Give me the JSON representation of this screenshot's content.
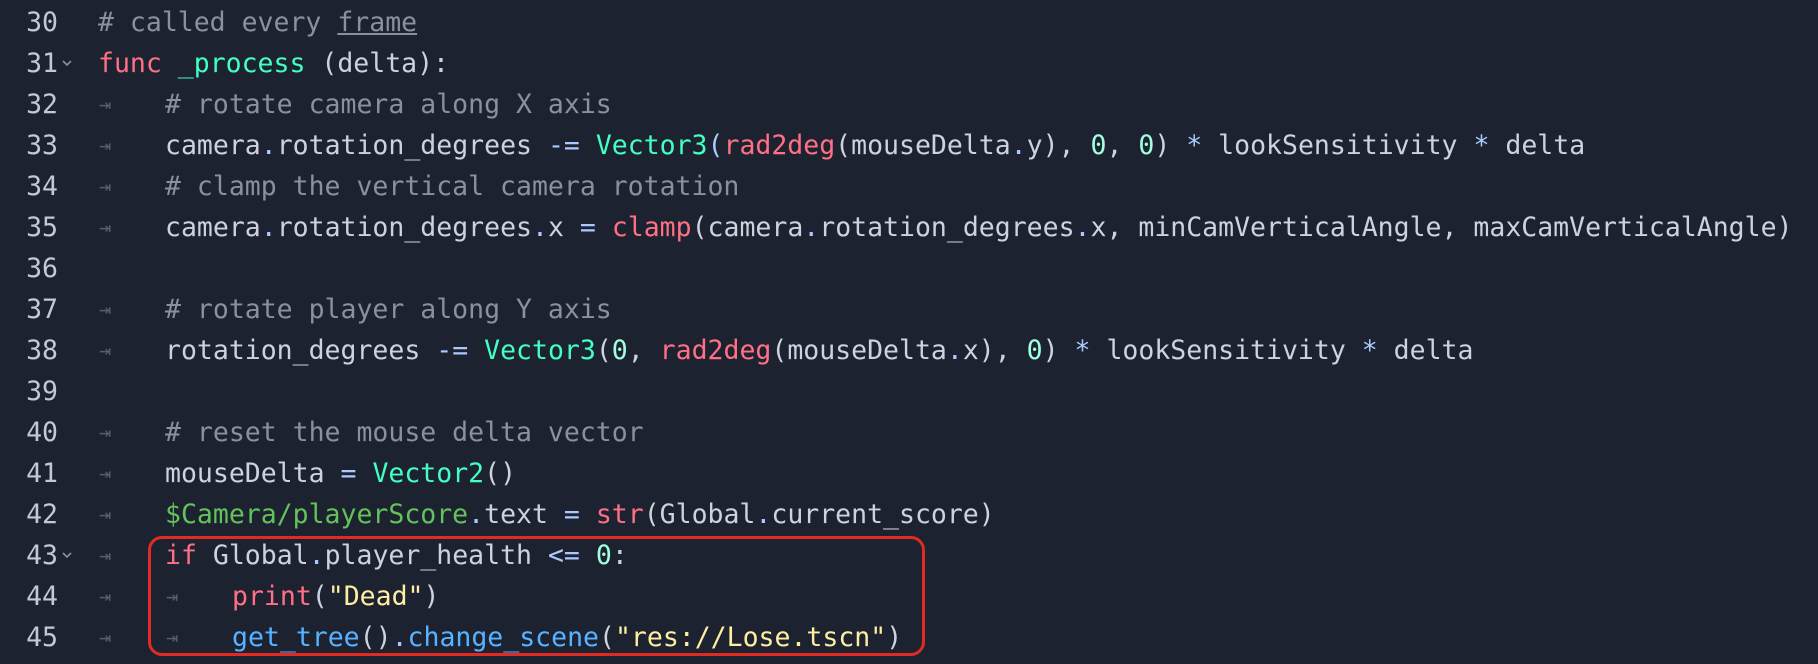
{
  "editor": {
    "lines": [
      {
        "num": "30",
        "indent": 0,
        "fold": false,
        "tokens": [
          {
            "t": "# called every ",
            "c": "comment"
          },
          {
            "t": "frame",
            "c": "comment u"
          }
        ]
      },
      {
        "num": "31",
        "indent": 0,
        "fold": true,
        "tokens": [
          {
            "t": "func ",
            "c": "keyword"
          },
          {
            "t": "_process",
            "c": "type"
          },
          {
            "t": " (delta):",
            "c": ""
          }
        ]
      },
      {
        "num": "32",
        "indent": 1,
        "fold": false,
        "tokens": [
          {
            "t": "# rotate camera along X axis",
            "c": "comment"
          }
        ]
      },
      {
        "num": "33",
        "indent": 1,
        "fold": false,
        "tokens": [
          {
            "t": "camera",
            "c": ""
          },
          {
            "t": ".",
            "c": "op"
          },
          {
            "t": "rotation_degrees ",
            "c": ""
          },
          {
            "t": "-=",
            "c": "op"
          },
          {
            "t": " ",
            "c": ""
          },
          {
            "t": "Vector3",
            "c": "type"
          },
          {
            "t": "(",
            "c": "op"
          },
          {
            "t": "rad2deg",
            "c": "builtin"
          },
          {
            "t": "(mouseDelta",
            "c": ""
          },
          {
            "t": ".",
            "c": "op"
          },
          {
            "t": "y), ",
            "c": ""
          },
          {
            "t": "0",
            "c": "num"
          },
          {
            "t": ", ",
            "c": ""
          },
          {
            "t": "0",
            "c": "num"
          },
          {
            "t": ") ",
            "c": ""
          },
          {
            "t": "*",
            "c": "op"
          },
          {
            "t": " lookSensitivity ",
            "c": ""
          },
          {
            "t": "*",
            "c": "op"
          },
          {
            "t": " delta",
            "c": ""
          }
        ]
      },
      {
        "num": "34",
        "indent": 1,
        "fold": false,
        "tokens": [
          {
            "t": "# clamp the vertical camera rotation",
            "c": "comment"
          }
        ]
      },
      {
        "num": "35",
        "indent": 1,
        "fold": false,
        "tokens": [
          {
            "t": "camera",
            "c": ""
          },
          {
            "t": ".",
            "c": "op"
          },
          {
            "t": "rotation_degrees",
            "c": ""
          },
          {
            "t": ".",
            "c": "op"
          },
          {
            "t": "x ",
            "c": ""
          },
          {
            "t": "=",
            "c": "op"
          },
          {
            "t": " ",
            "c": ""
          },
          {
            "t": "clamp",
            "c": "builtin"
          },
          {
            "t": "(camera",
            "c": ""
          },
          {
            "t": ".",
            "c": "op"
          },
          {
            "t": "rotation_degrees",
            "c": ""
          },
          {
            "t": ".",
            "c": "op"
          },
          {
            "t": "x, minCamVerticalAngle, maxCamVerticalAngle)",
            "c": ""
          }
        ]
      },
      {
        "num": "36",
        "indent": 0,
        "fold": false,
        "tokens": []
      },
      {
        "num": "37",
        "indent": 1,
        "fold": false,
        "tokens": [
          {
            "t": "# rotate player along Y axis",
            "c": "comment"
          }
        ]
      },
      {
        "num": "38",
        "indent": 1,
        "fold": false,
        "tokens": [
          {
            "t": "rotation_degrees ",
            "c": ""
          },
          {
            "t": "-=",
            "c": "op"
          },
          {
            "t": " ",
            "c": ""
          },
          {
            "t": "Vector3",
            "c": "type"
          },
          {
            "t": "(",
            "c": ""
          },
          {
            "t": "0",
            "c": "num"
          },
          {
            "t": ", ",
            "c": ""
          },
          {
            "t": "rad2deg",
            "c": "builtin"
          },
          {
            "t": "(mouseDelta",
            "c": ""
          },
          {
            "t": ".",
            "c": "op"
          },
          {
            "t": "x), ",
            "c": ""
          },
          {
            "t": "0",
            "c": "num"
          },
          {
            "t": ") ",
            "c": ""
          },
          {
            "t": "*",
            "c": "op"
          },
          {
            "t": " lookSensitivity ",
            "c": ""
          },
          {
            "t": "*",
            "c": "op"
          },
          {
            "t": " delta",
            "c": ""
          }
        ]
      },
      {
        "num": "39",
        "indent": 0,
        "fold": false,
        "tokens": []
      },
      {
        "num": "40",
        "indent": 1,
        "fold": false,
        "tokens": [
          {
            "t": "# reset the mouse delta vector",
            "c": "comment"
          }
        ]
      },
      {
        "num": "41",
        "indent": 1,
        "fold": false,
        "tokens": [
          {
            "t": "mouseDelta ",
            "c": ""
          },
          {
            "t": "=",
            "c": "op"
          },
          {
            "t": " ",
            "c": ""
          },
          {
            "t": "Vector2",
            "c": "type"
          },
          {
            "t": "()",
            "c": ""
          }
        ]
      },
      {
        "num": "42",
        "indent": 1,
        "fold": false,
        "tokens": [
          {
            "t": "$Camera/playerScore",
            "c": "node"
          },
          {
            "t": ".",
            "c": "op"
          },
          {
            "t": "text ",
            "c": ""
          },
          {
            "t": "=",
            "c": "op"
          },
          {
            "t": " ",
            "c": ""
          },
          {
            "t": "str",
            "c": "builtin"
          },
          {
            "t": "(Global",
            "c": ""
          },
          {
            "t": ".",
            "c": "op"
          },
          {
            "t": "current_score)",
            "c": ""
          }
        ]
      },
      {
        "num": "43",
        "indent": 1,
        "fold": true,
        "tokens": [
          {
            "t": "if",
            "c": "keyword"
          },
          {
            "t": " Global",
            "c": ""
          },
          {
            "t": ".",
            "c": "op"
          },
          {
            "t": "player_health ",
            "c": ""
          },
          {
            "t": "<=",
            "c": "op"
          },
          {
            "t": " ",
            "c": ""
          },
          {
            "t": "0",
            "c": "num"
          },
          {
            "t": ":",
            "c": ""
          }
        ]
      },
      {
        "num": "44",
        "indent": 2,
        "fold": false,
        "tokens": [
          {
            "t": "print",
            "c": "builtin"
          },
          {
            "t": "(",
            "c": ""
          },
          {
            "t": "\"Dead\"",
            "c": "str"
          },
          {
            "t": ")",
            "c": ""
          }
        ]
      },
      {
        "num": "45",
        "indent": 2,
        "fold": false,
        "tokens": [
          {
            "t": "get_tree",
            "c": "func"
          },
          {
            "t": "()",
            "c": ""
          },
          {
            "t": ".",
            "c": "op"
          },
          {
            "t": "change_scene",
            "c": "func"
          },
          {
            "t": "(",
            "c": ""
          },
          {
            "t": "\"res://Lose.tscn\"",
            "c": "str"
          },
          {
            "t": ")",
            "c": ""
          }
        ]
      }
    ]
  },
  "colors": {
    "background": "#1d2230",
    "line_number": "#c3c8d4",
    "comment": "#8a909e",
    "keyword": "#ff7085",
    "type": "#42ffc2",
    "number": "#a1ffe0",
    "string": "#ffeda1",
    "function": "#57b3ff",
    "node_path": "#63c259",
    "highlight_box": "#e02a22"
  },
  "icons": {
    "fold_marker": "chevron-down-icon",
    "indent_marker": "tab-indent-icon"
  }
}
